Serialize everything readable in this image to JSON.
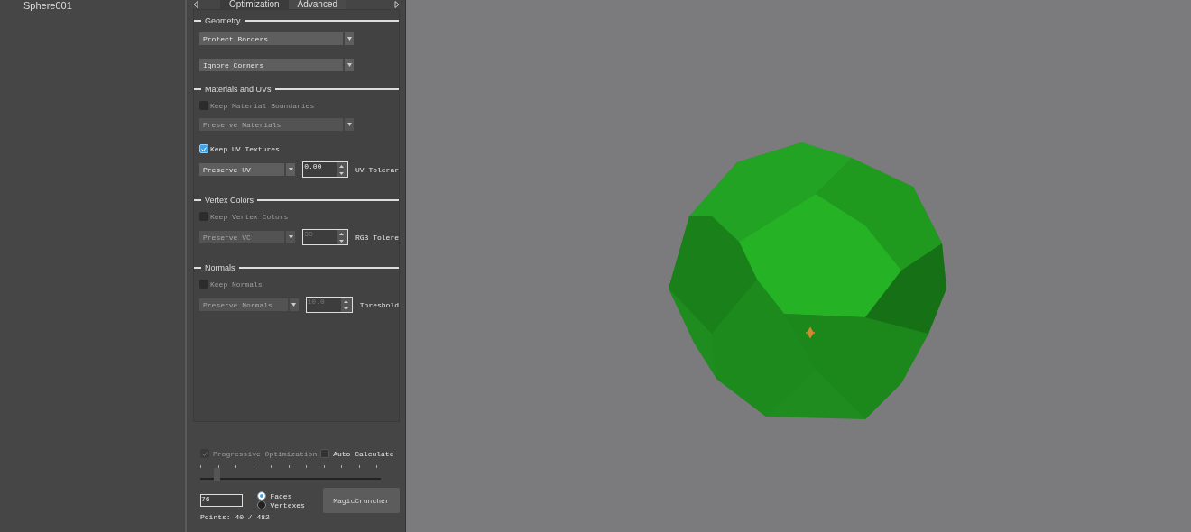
{
  "scene_tree": {
    "items": [
      {
        "label": "Sphere001"
      }
    ]
  },
  "tabs": [
    {
      "label": "Optimization",
      "selected": true
    },
    {
      "label": "Advanced",
      "selected": false
    }
  ],
  "groups": [
    {
      "title": "Geometry",
      "rows": [
        {
          "kind": "dropdown",
          "value": "Protect Borders",
          "disabled": false
        },
        {
          "kind": "dropdown",
          "value": "Ignore Corners",
          "disabled": false
        }
      ]
    },
    {
      "title": "Materials and UVs",
      "rows": [
        {
          "kind": "checkbox",
          "label": "Keep Material Boundaries",
          "checked": false,
          "disabled": true
        },
        {
          "kind": "dropdown",
          "value": "Preserve Materials",
          "disabled": true
        },
        {
          "kind": "checkbox",
          "label": "Keep UV Textures",
          "checked": true,
          "disabled": false
        },
        {
          "kind": "dropdown_spinner",
          "value": "Preserve UV",
          "spinner": "0.00",
          "spinner_label": "UV Tolerar",
          "disabled": false
        }
      ]
    },
    {
      "title": "Vertex Colors",
      "rows": [
        {
          "kind": "checkbox",
          "label": "Keep Vertex Colors",
          "checked": false,
          "disabled": true
        },
        {
          "kind": "dropdown_spinner",
          "value": "Preserve VC",
          "spinner": "30",
          "spinner_label": "RGB Tolere",
          "disabled": true
        }
      ]
    },
    {
      "title": "Normals",
      "rows": [
        {
          "kind": "checkbox",
          "label": "Keep Normals",
          "checked": false,
          "disabled": true
        },
        {
          "kind": "dropdown_spinner",
          "value": "Preserve Normals",
          "spinner": "10.0",
          "spinner_label": "Threshold",
          "disabled": true
        }
      ]
    }
  ],
  "bottom": {
    "progressive": {
      "label": "Progressive Optimization",
      "checked": true,
      "disabled": true
    },
    "auto_calculate": {
      "label": "Auto Calculate",
      "checked": false
    },
    "slider": {
      "level": 0.08
    },
    "amount": "76",
    "modes": [
      {
        "label": "Faces",
        "selected": true
      },
      {
        "label": "Vertexes",
        "selected": false
      }
    ],
    "button": "MagicCruncher",
    "points": "Points: 40 / 482"
  }
}
